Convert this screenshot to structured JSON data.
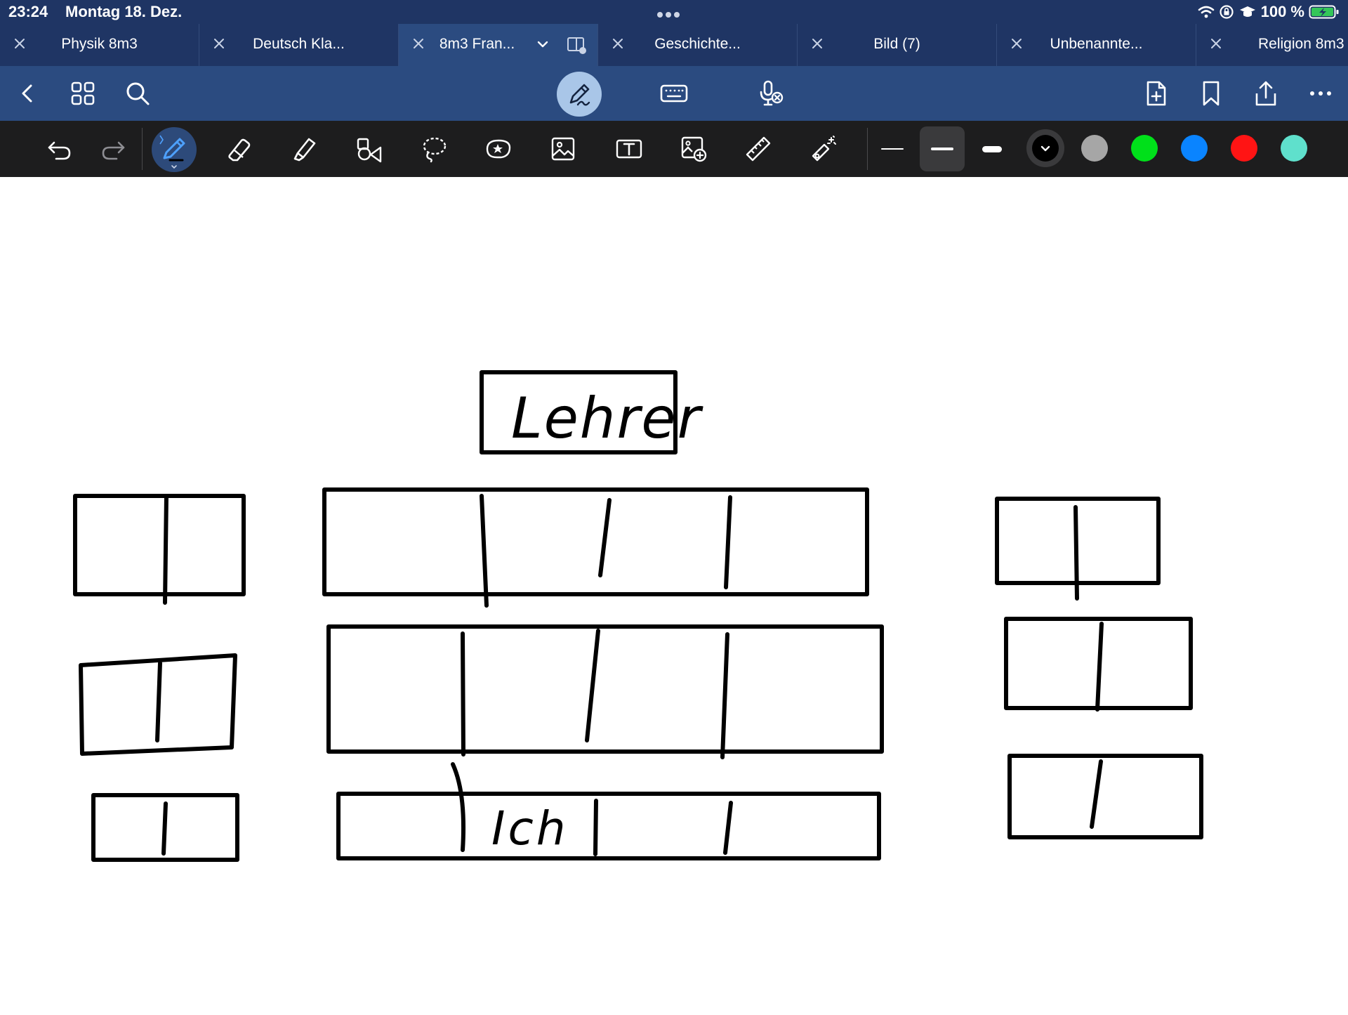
{
  "status_bar": {
    "time": "23:24",
    "date": "Montag 18. Dez.",
    "battery": "100 %",
    "icons": [
      "wifi-icon",
      "lock-rotation-icon",
      "cap-icon",
      "battery-charging-icon"
    ]
  },
  "tabs": [
    {
      "label": "Physik 8m3",
      "active": false
    },
    {
      "label": "Deutsch Kla...",
      "active": false
    },
    {
      "label": "8m3 Fran...",
      "active": true
    },
    {
      "label": "Geschichte...",
      "active": false
    },
    {
      "label": "Bild (7)",
      "active": false
    },
    {
      "label": "Unbenannte...",
      "active": false
    },
    {
      "label": "Religion 8m3",
      "active": false
    }
  ],
  "nav_toolbar": {
    "left_icons": [
      "back-icon",
      "grid-icon",
      "search-icon"
    ],
    "center_icons": [
      "pen-mode-icon",
      "keyboard-icon",
      "microphone-off-icon"
    ],
    "right_icons": [
      "add-page-icon",
      "bookmark-icon",
      "share-icon",
      "more-icon"
    ]
  },
  "tools_toolbar": {
    "tools": [
      "undo-icon",
      "redo-icon",
      "pen-icon",
      "eraser-icon",
      "highlighter-icon",
      "shapes-icon",
      "lasso-icon",
      "sticker-icon",
      "image-icon",
      "text-box-icon",
      "camera-image-icon",
      "ruler-icon",
      "laser-pointer-icon"
    ],
    "stroke_widths": [
      "thin",
      "medium",
      "thick"
    ],
    "selected_stroke": "medium",
    "colors": [
      "#000000",
      "#a6a6a6",
      "#00e01a",
      "#0a84ff",
      "#ff1414",
      "#5fe0cc"
    ],
    "selected_color": "#000000",
    "accent": "#2b4b80"
  },
  "canvas": {
    "handwritten_texts": [
      "Lehrer",
      "Ich"
    ]
  }
}
